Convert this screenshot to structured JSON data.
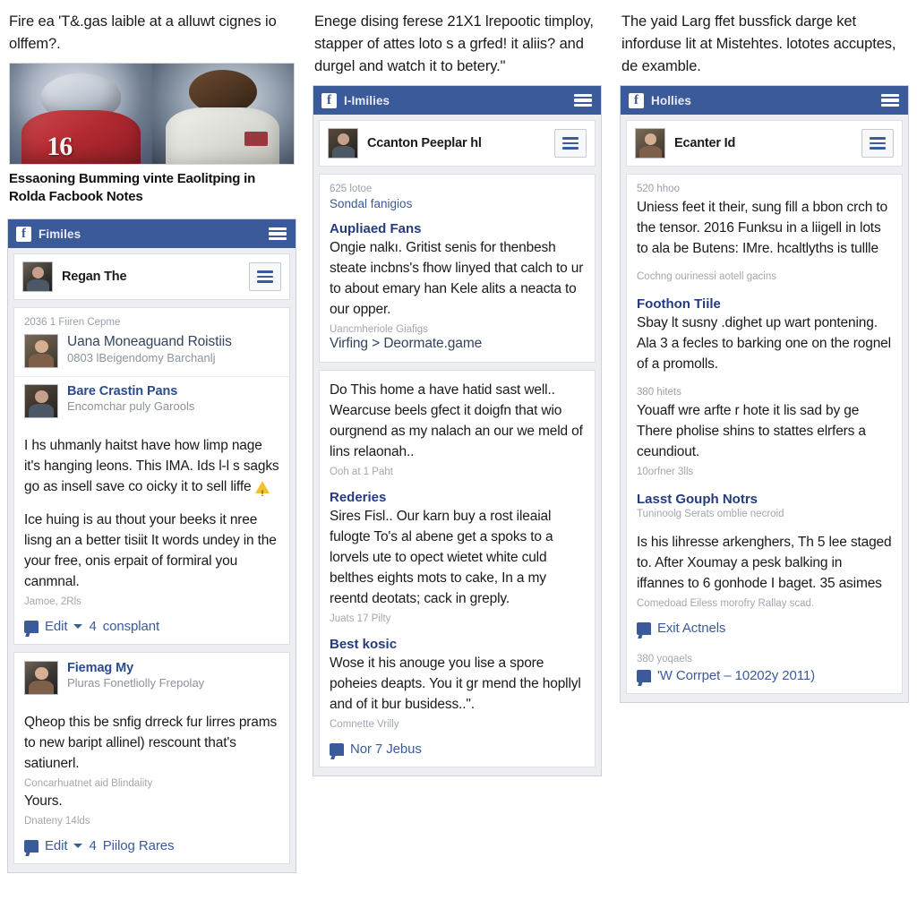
{
  "columns": [
    {
      "intro": "Fire ea 'T&.gas laible at a alluwt cignes io olffem?.",
      "hero": {
        "left_jersey_number": "16",
        "caption": "Essaoning Bumming vinte Eaolitping in Rolda Facbook Notes"
      },
      "mock": {
        "app_bar": {
          "logo": "f",
          "title": "Fimiles",
          "menu_icon": "hamburger-icon"
        },
        "profile": {
          "name": "Regan The",
          "menu_icon": "hamburger-icon"
        },
        "list_card": {
          "meta": "2036 1 Fiiren Cepme",
          "people": [
            {
              "name": "Uana Moneaguand Roistiis",
              "sub": "0803 lBeigendomy Barchanlj"
            },
            {
              "name": "Bare Crastin Pans",
              "sub": "Encomchar puly Garools"
            }
          ]
        },
        "post_card": {
          "paragraphs": [
            "I hs uhmanly haitst have how limp nage it's hanging leons. This IMA. Ids l-l s sagks go as insell save co oicky it to sell liffe",
            "Ice huing is au thout your beeks it nree lisng an a better tisiit It words undey in the your free, onis erpait of formiral you canmnal."
          ],
          "has_warning_icon": true,
          "timestamp": "Jamoe, 2Rls",
          "actions": {
            "edit_label": "Edit",
            "count": "4",
            "comments_label": "consplant"
          }
        },
        "post_card_2": {
          "author": "Fiemag My",
          "author_sub": "Pluras Fonetliolly Frepolay",
          "body": "Qheop this be snfig drreck fur lirres prams to new baript allinel) rescount that's satiunerl.",
          "note": "Concarhuatnet aid Blindaiity",
          "signoff": "Yours.",
          "timestamp": "Dnateny 14lds",
          "actions": {
            "edit_label": "Edit",
            "count": "4",
            "comments_label": "Piilog Rares"
          }
        }
      }
    },
    {
      "intro": "Enege dising ferese 21X1 lrepootic timploy, stapper of attes loto s a grfed! it aliis? and durgel and watch it to betery.\"",
      "mock": {
        "app_bar": {
          "logo": "f",
          "title": "I-Imilies",
          "menu_icon": "hamburger-icon"
        },
        "profile": {
          "name": "Ccanton Peeplar hl",
          "menu_icon": "hamburger-icon"
        },
        "card_1": {
          "meta": "625 lotoe",
          "meta_blue": "Sondal fanigios",
          "heading": "Aupliaed Fans",
          "body": "Ongie nalkı. Gritist senis for thenbesh steate incbns's fhow linyed that calch to ur to about emary han Kele alits a neacta to our opper.",
          "note": "Uancmheriole Giafigs",
          "link": "Virfing > Deormate.game"
        },
        "card_2": {
          "body": "Do This home a have hatid sast well.. Wearcuse beels gfect it doigfn that wio ourgnend as my nalach an our we meld of lins relaonah..",
          "timestamp": "Ooh at 1 Paht",
          "heading": "Rederies",
          "body_2": "Sires Fisl.. Our karn buy a rost ileaial fulogte To's al abene get a spoks to a lorvels ute to opect wietet white culd belthes eights mots to cake, In a my reentd deotats; cack in greply.",
          "timestamp_2": "Juats 17 Pilty",
          "heading_3": "Best kosic",
          "body_3": "Wose it his anouge you lise a spore poheies deapts. You it gr mend the hopllyl and of it bur busidess..\".",
          "timestamp_3": "Comnette Vrilly",
          "action": {
            "label": "Nor 7 Jebus"
          }
        }
      }
    },
    {
      "intro": "The yaid Larg ffet bussfick darge ket inforduse lit at Mistehtes. lototes accuptes, de examble.",
      "mock": {
        "app_bar": {
          "logo": "f",
          "title": "Hollies",
          "menu_icon": "hamburger-icon"
        },
        "profile": {
          "name": "Ecanter Id",
          "menu_icon": "hamburger-icon"
        },
        "card_1": {
          "meta": "520 hhoo",
          "body": "Uniess feet it their, sung fill a bbon crch to the tensor. 2016 Funksu in a liigell in lots to ala be Butens: IMre. hcaltlyths is tullle",
          "note": "Cochng ourinessi aotell gacins",
          "heading": "Foothon Tiile",
          "body_2": "Sbay lt susny .dighet up wart pontening. Ala 3 a fecles to barking one on the rognel of a promolls.",
          "meta_2": "380 hitets",
          "body_3": "Youaff wre arfte r hote it lis sad by ge There pholise shins to stattes elrfers a ceundiout.",
          "meta_3": "10orfner 3lls",
          "heading_2": "Lasst Gouph Notrs",
          "note_2": "Tuninoolg Serats omblie necroid",
          "body_4": "Is his lihresse arkenghers, Th 5 lee staged to. After Xoumay a pesk balking in iffannes to 6 gonhode I baget. 35 asimes",
          "note_3": "Comedoad Eiless morofry Rallay scad.",
          "action": {
            "label": "Exit Actnels"
          },
          "meta_4": "380 yoqaels",
          "action_2": {
            "label": "'W Corrpet – 10202y 2011)"
          }
        }
      }
    }
  ],
  "colors": {
    "facebook_blue": "#3b5a9a",
    "link_blue": "#33435e",
    "heading_blue": "#253b80",
    "muted_grey": "#9aa0a8",
    "warning_yellow": "#f2c12e",
    "page_background": "#ffffff",
    "card_background": "#ffffff",
    "mock_background": "#eceef2"
  }
}
